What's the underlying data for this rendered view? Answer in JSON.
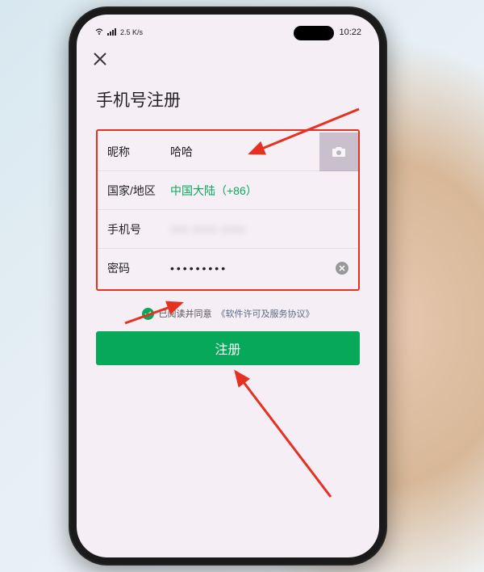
{
  "status_bar": {
    "network_speed": "2.5 K/s",
    "time": "10:22"
  },
  "page": {
    "title": "手机号注册"
  },
  "form": {
    "nickname": {
      "label": "昵称",
      "value": "哈哈"
    },
    "region": {
      "label": "国家/地区",
      "value": "中国大陆（+86）"
    },
    "phone": {
      "label": "手机号",
      "value": ""
    },
    "password": {
      "label": "密码",
      "value": "•••••••••"
    }
  },
  "agreement": {
    "prefix": "已阅读并同意",
    "link": "《软件许可及服务协议》"
  },
  "buttons": {
    "register": "注册"
  }
}
